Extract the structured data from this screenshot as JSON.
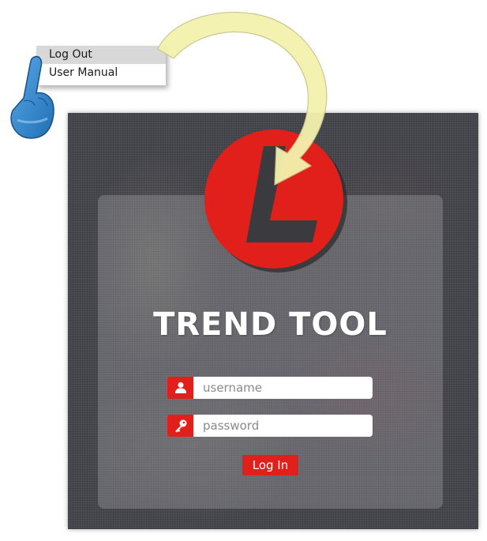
{
  "menu": {
    "items": [
      {
        "label": "Log Out",
        "state": "hover"
      },
      {
        "label": "User Manual"
      }
    ]
  },
  "login": {
    "title": "TREND TOOL",
    "username_placeholder": "username",
    "password_placeholder": "password",
    "submit_label": "Log In",
    "username_icon": "user-icon",
    "password_icon": "key-icon"
  },
  "decorations": {
    "logo": "red-L-logo",
    "pointer": "pointing-hand-icon",
    "arrow": "curved-arrow"
  },
  "colors": {
    "accent": "#e2201b",
    "screen_bg": "#4b4b52",
    "arrow_fill": "#f5f3b0",
    "hand_blue": "#2f86cc"
  }
}
